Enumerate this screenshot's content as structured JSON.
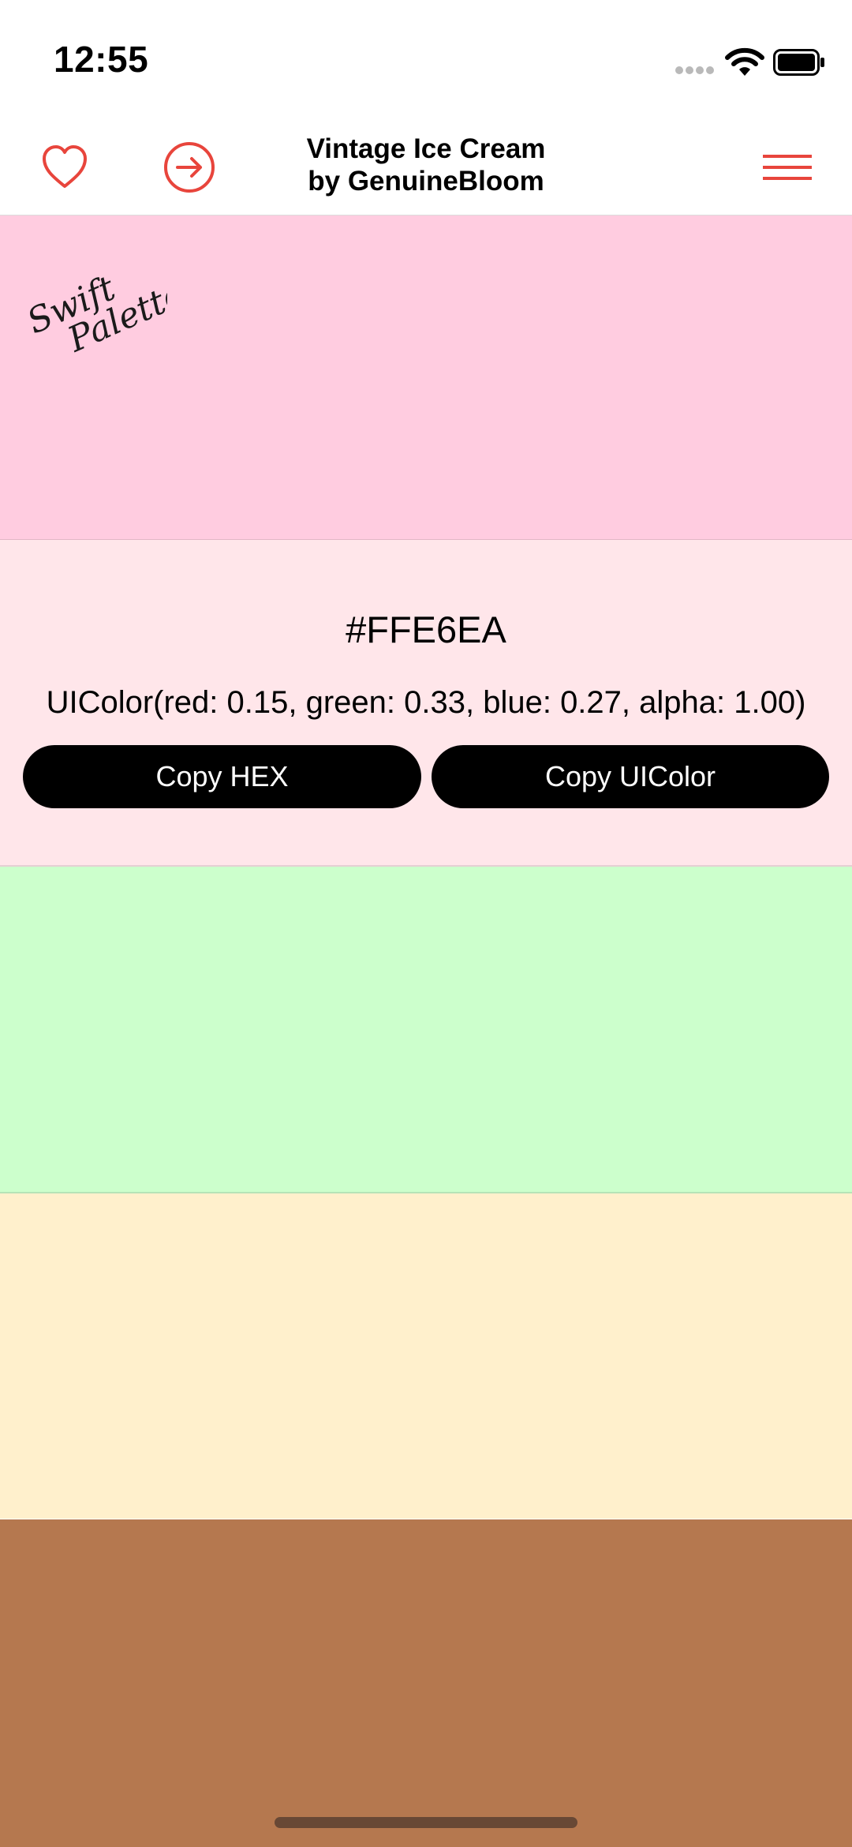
{
  "status_bar": {
    "time": "12:55"
  },
  "nav": {
    "title_line1": "Vintage Ice Cream",
    "title_line2": "by GenuineBloom",
    "icons": [
      "heart-icon",
      "arrow-right-circle-icon",
      "hamburger-menu-icon"
    ],
    "accent_color": "#E8453C"
  },
  "logo": {
    "line1": "Swift",
    "line2": "Palette"
  },
  "palette": {
    "colors": [
      "#FFCCE0",
      "#FFE6EA",
      "#CCFFCC",
      "#FFF0CC",
      "#B5784F"
    ],
    "selected": {
      "hex": "#FFE6EA",
      "uicolor": "UIColor(red: 0.15, green: 0.33, blue: 0.27, alpha: 1.00)"
    },
    "copy_hex_label": "Copy HEX",
    "copy_uicolor_label": "Copy UIColor"
  }
}
